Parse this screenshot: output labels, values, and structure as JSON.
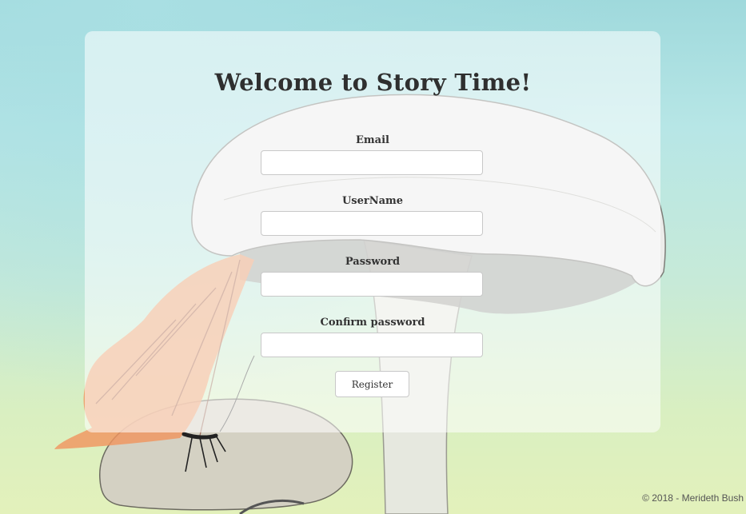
{
  "title": "Welcome to Story Time!",
  "form": {
    "email_label": "Email",
    "email_value": "",
    "username_label": "UserName",
    "username_value": "",
    "password_label": "Password",
    "password_value": "",
    "confirm_label": "Confirm password",
    "confirm_value": "",
    "register_label": "Register"
  },
  "footer": "© 2018 - Merideth Bush",
  "colors": {
    "background_top": "#9fd9dc",
    "background_bottom": "#e3f1bb",
    "butterfly": "#f0955f"
  }
}
